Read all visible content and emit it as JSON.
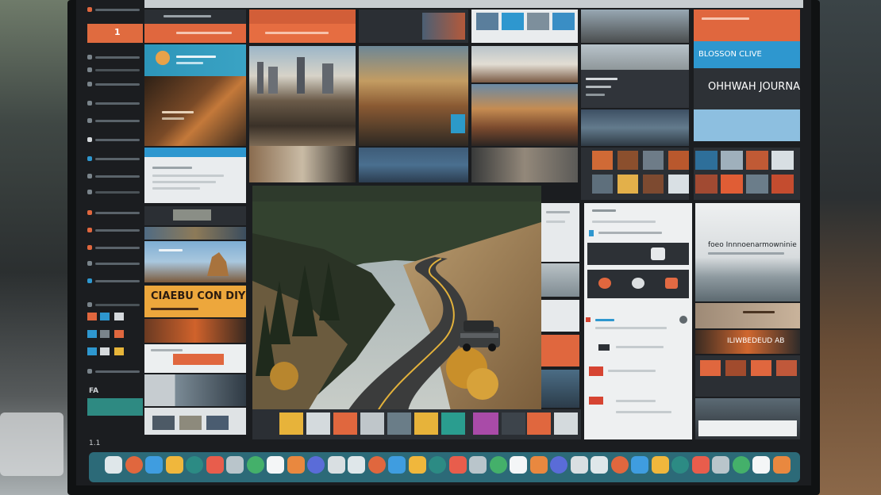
{
  "sidebar": {
    "highlight_label": "1",
    "section_label": "FA",
    "footer_label": "1.1"
  },
  "headlines": {
    "top_right_blue": "BLOSSON CLIVE",
    "top_right_dark": "OHHWAH JOURNAI",
    "left_orange_banner": "CIAEBU   CON DIYG",
    "right_mid_headline": "foeo Innnoenarmowninie",
    "right_orange_banner": "ILIWBEDEUD  AB"
  },
  "hero": {
    "scene": "winding-road-forest"
  },
  "dock": {
    "icon_count": 34
  },
  "colors": {
    "accent_orange": "#e0673e",
    "accent_blue": "#2e97cf",
    "accent_teal": "#2c8b84",
    "dock_bar": "#2c6a78"
  }
}
